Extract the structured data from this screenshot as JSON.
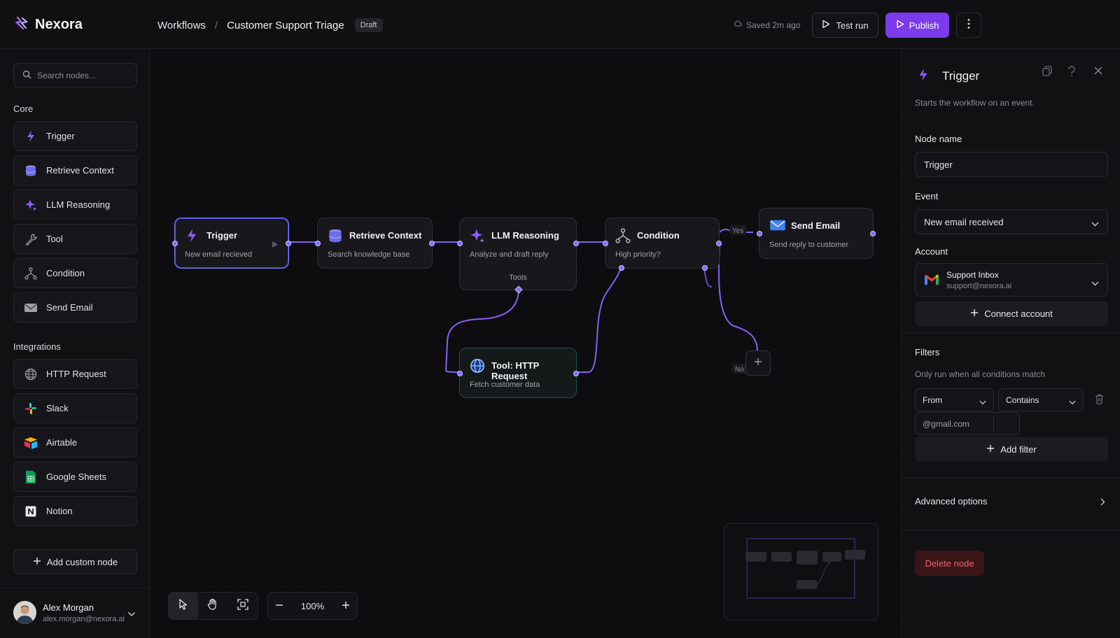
{
  "app": {
    "name": "Nexora"
  },
  "breadcrumb": {
    "root": "Workflows",
    "current": "Customer Support Triage",
    "badge": "Draft"
  },
  "header": {
    "saved": "Saved 2m ago",
    "test_run": "Test run",
    "publish": "Publish",
    "accent": "#7c3aed"
  },
  "sidebar": {
    "search_placeholder": "Search nodes...",
    "core_label": "Core",
    "core_items": [
      {
        "label": "Trigger",
        "icon": "lightning-icon"
      },
      {
        "label": "Retrieve Context",
        "icon": "database-icon"
      },
      {
        "label": "LLM Reasoning",
        "icon": "sparkle-icon"
      },
      {
        "label": "Tool",
        "icon": "wrench-icon"
      },
      {
        "label": "Condition",
        "icon": "branch-icon"
      },
      {
        "label": "Send Email",
        "icon": "mail-icon"
      }
    ],
    "integrations_label": "Integrations",
    "integration_items": [
      {
        "label": "HTTP Request",
        "icon": "globe-icon"
      },
      {
        "label": "Slack",
        "icon": "slack-icon"
      },
      {
        "label": "Airtable",
        "icon": "airtable-icon"
      },
      {
        "label": "Google Sheets",
        "icon": "sheets-icon"
      },
      {
        "label": "Notion",
        "icon": "notion-icon"
      }
    ],
    "add_custom": "Add custom node"
  },
  "user": {
    "name": "Alex Morgan",
    "email": "alex.morgan@nexora.ai"
  },
  "canvas": {
    "nodes": {
      "trigger": {
        "title": "Trigger",
        "sub": "New email recieved"
      },
      "retrieve": {
        "title": "Retrieve Context",
        "sub": "Search knowledge base"
      },
      "llm": {
        "title": "LLM Reasoning",
        "sub": "Analyze and draft reply",
        "tools": "Tools"
      },
      "condition": {
        "title": "Condition",
        "sub": "High priority?"
      },
      "send": {
        "title": "Send Email",
        "sub": "Send reply to customer"
      },
      "http": {
        "title": "Tool: HTTP Request",
        "sub": "Fetch customer data"
      }
    },
    "edge_yes": "Yes",
    "edge_no": "No",
    "zoom": "100%"
  },
  "panel": {
    "title": "Trigger",
    "desc": "Starts the workflow on an event.",
    "node_name_label": "Node name",
    "node_name_value": "Trigger",
    "event_label": "Event",
    "event_value": "New email received",
    "account_label": "Account",
    "account_name": "Support Inbox",
    "account_email": "support@nexora.ai",
    "connect_account": "Connect account",
    "filters_label": "Filters",
    "filters_desc": "Only run when all conditions match",
    "filter_field": "From",
    "filter_op": "Contains",
    "filter_value": "@gmail.com",
    "add_filter": "Add filter",
    "advanced": "Advanced options",
    "delete": "Delete node"
  }
}
